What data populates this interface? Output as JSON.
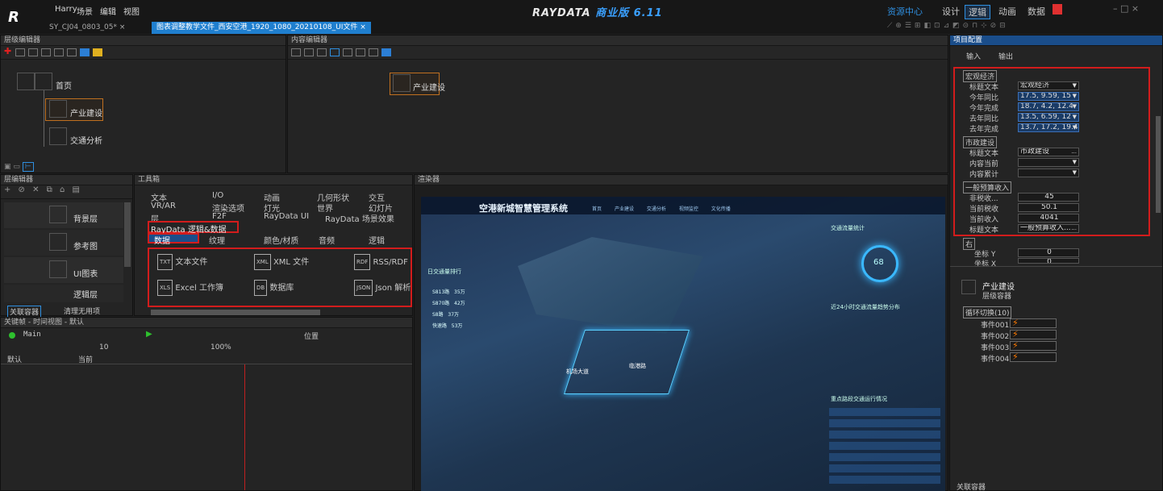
{
  "user": "Harry",
  "menu": [
    "场景",
    "编辑",
    "视图"
  ],
  "tabs": [
    "SY_CJ04_0803_05*",
    "图表调整教学文件_西安空港_1920_1080_20210108_UI文件"
  ],
  "brand": {
    "name": "RAYDATA",
    "edition": "商业版 6.11"
  },
  "top_right": [
    "资源中心",
    "设计",
    "逻辑",
    "动画",
    "数据"
  ],
  "panels": {
    "layer_editor": "层级编辑器",
    "content_editor": "内容编辑器",
    "layer_editor2": "层编辑器",
    "toolbox": "工具箱",
    "renderer": "渲染器",
    "project_config": "项目配置",
    "keyframe": "关键帧 - 时间视图 - 默认"
  },
  "layer_nodes": [
    "首页",
    "产业建设",
    "交通分析"
  ],
  "content_node": "产业建设",
  "layers": [
    "背景层",
    "参考图",
    "UI图表",
    "逻辑层"
  ],
  "layer_footer": [
    "关联容器",
    "清理无用项"
  ],
  "toolbox_items": {
    "row1": [
      "文本",
      "I/O",
      "动画",
      "几何形状",
      "交互"
    ],
    "row2": [
      "VR/AR",
      "渲染选项",
      "灯光",
      "世界",
      "幻灯片"
    ],
    "row3": [
      "层",
      "F2F",
      "RayData UI",
      "RayData 场景效果"
    ],
    "row4": [
      "RayData 逻辑&数据"
    ],
    "row5": [
      "数据",
      "纹理",
      "颜色/材质",
      "音频",
      "逻辑"
    ]
  },
  "data_tiles": [
    {
      "icon": "TXT",
      "label": "文本文件"
    },
    {
      "icon": "XML",
      "label": "XML 文件"
    },
    {
      "icon": "RDF",
      "label": "RSS/RDF 消"
    },
    {
      "icon": "XLS",
      "label": "Excel 工作簿"
    },
    {
      "icon": "DB",
      "label": "数据库"
    },
    {
      "icon": "JSON",
      "label": "Json 解析器"
    }
  ],
  "keyframe": {
    "main": "Main",
    "num": "10",
    "zoom": "100%",
    "pos": "位置",
    "cols": [
      "默认",
      "当前"
    ]
  },
  "screen": {
    "title": "空港新城智慧管理系统",
    "nav": [
      "首页",
      "产业建设",
      "交通分析",
      "视频监控",
      "文化传播"
    ],
    "panels": [
      "交通流量统计",
      "日交通量排行",
      "近24小时交通流量趋势分布",
      "重点路段交通运行情况"
    ],
    "rank_rows": [
      [
        "S813路",
        "35万"
      ],
      [
        "S870路",
        "42万"
      ],
      [
        "S8路",
        "37万"
      ],
      [
        "快速路",
        "53万"
      ]
    ],
    "gauge": "68",
    "labels": [
      "机场大道",
      "临港路"
    ]
  },
  "config": {
    "io": [
      "输入",
      "输出"
    ],
    "groups": [
      {
        "name": "宏观经济",
        "rows": [
          [
            "标题文本",
            "宏观经济"
          ],
          [
            "今年同比",
            "17.5, 9.59, 15"
          ],
          [
            "今年完成",
            "18.7, 4.2, 12.4"
          ],
          [
            "去年同比",
            "13.5, 6.59, 12"
          ],
          [
            "去年完成",
            "13.7, 17.2, 19.4"
          ]
        ]
      },
      {
        "name": "市政建设",
        "rows": [
          [
            "标题文本",
            "市政建设"
          ],
          [
            "内容当前",
            ""
          ],
          [
            "内容累计",
            ""
          ]
        ]
      },
      {
        "name": "一般预算收入",
        "rows": [
          [
            "非税收...",
            "45"
          ],
          [
            "当前税收",
            "50.1"
          ],
          [
            "当前收入",
            "4041"
          ],
          [
            "标题文本",
            "一般预算收入..."
          ]
        ]
      },
      {
        "name": "右",
        "rows": [
          [
            "坐标 Y",
            "0"
          ],
          [
            "坐标 X",
            "0"
          ]
        ]
      }
    ],
    "node": {
      "title": "产业建设",
      "sub": "层级容器"
    },
    "loop": "循环切换(10)",
    "events": [
      "事件001",
      "事件002",
      "事件003",
      "事件004"
    ],
    "footer": "关联容器"
  }
}
